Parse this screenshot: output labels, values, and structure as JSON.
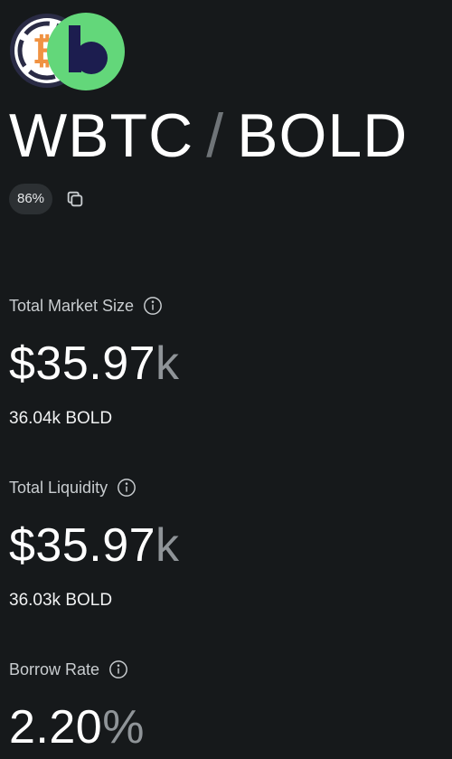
{
  "pair": {
    "base": "WBTC",
    "separator": "/",
    "quote": "BOLD",
    "ltv_badge": "86%"
  },
  "icons": {
    "base_logo": "wbtc-logo",
    "quote_logo": "bold-logo",
    "copy": "copy-icon",
    "info": "info-icon"
  },
  "colors": {
    "background": "#16191b",
    "wbtc_orange": "#f09242",
    "bold_green": "#63d77a",
    "bold_navy": "#1c1d4f",
    "muted_unit": "#8f9498"
  },
  "metrics": {
    "market_size": {
      "label": "Total Market Size",
      "value": "$35.97",
      "unit": "k",
      "sub": "36.04k BOLD"
    },
    "liquidity": {
      "label": "Total Liquidity",
      "value": "$35.97",
      "unit": "k",
      "sub": "36.03k BOLD"
    },
    "borrow_rate": {
      "label": "Borrow Rate",
      "value": "2.20",
      "unit": "%"
    }
  }
}
